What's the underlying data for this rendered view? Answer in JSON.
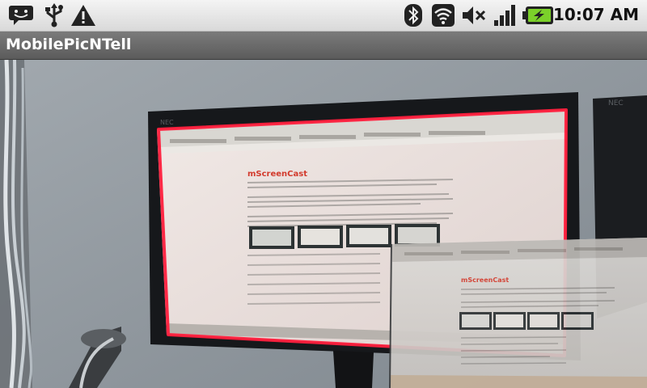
{
  "status_bar": {
    "icons": [
      "notification-icon",
      "usb-icon",
      "warning-icon",
      "bluetooth-icon",
      "wifi-icon",
      "muted-icon",
      "signal-icon",
      "battery-charging-icon"
    ],
    "time": "10:07 AM"
  },
  "app": {
    "title": "MobilePicNTell"
  },
  "camera_view": {
    "captured_page_heading": "mScreenCast",
    "preview_page_heading": "mScreenCast",
    "monitor_brand": "NEC",
    "detection_box_color": "#ff1f3d"
  }
}
